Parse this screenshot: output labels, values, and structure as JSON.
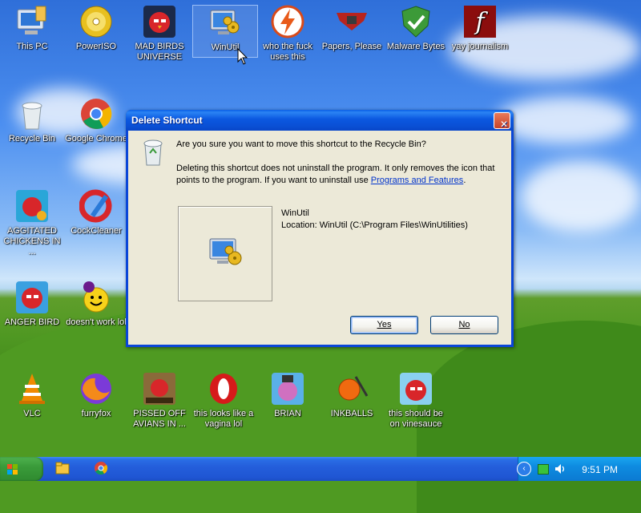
{
  "desktop": {
    "icons": [
      {
        "label": "This PC"
      },
      {
        "label": "PowerISO"
      },
      {
        "label": "MAD BIRDS UNIVERSE"
      },
      {
        "label": "WinUtil"
      },
      {
        "label": "who the fuck uses this"
      },
      {
        "label": "Papers, Please"
      },
      {
        "label": "Malware Bytes"
      },
      {
        "label": "yay journalism"
      },
      {
        "label": "Recycle Bin"
      },
      {
        "label": "Google Chrome"
      },
      {
        "label": "AGGITATED CHICKENS IN ..."
      },
      {
        "label": "CockCleaner"
      },
      {
        "label": "ANGER BIRD"
      },
      {
        "label": "doesn't work lol"
      },
      {
        "label": "VLC"
      },
      {
        "label": "furryfox"
      },
      {
        "label": "PISSED OFF AVIANS IN ..."
      },
      {
        "label": "this looks like a vagina lol"
      },
      {
        "label": "BRIAN"
      },
      {
        "label": "INKBALLS"
      },
      {
        "label": "this should be on vinesauce"
      }
    ]
  },
  "dialog": {
    "title": "Delete Shortcut",
    "question": "Are you sure you want to move this shortcut to the Recycle Bin?",
    "info_before_link": "Deleting this shortcut does not uninstall the program. It only removes the icon that points to the program. If you want to uninstall use ",
    "link": "Programs and Features",
    "info_after_link": ".",
    "item_name": "WinUtil",
    "item_location": "Location: WinUtil (C:\\Program Files\\WinUtilities)",
    "yes_label": "Yes",
    "no_label": "No"
  },
  "taskbar": {
    "clock": "9:51 PM"
  },
  "colors": {
    "title_blue": "#0a5de5",
    "dialog_face": "#ece9d8",
    "taskbar_blue": "#245edb",
    "start_green": "#3a9b3a"
  }
}
